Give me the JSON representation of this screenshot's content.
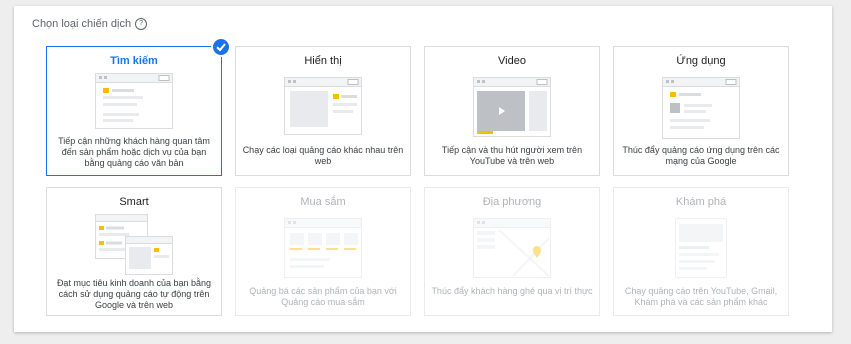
{
  "section": {
    "title": "Chọn loại chiến dịch",
    "help_icon": "help-circle-icon"
  },
  "colors": {
    "accent": "#1a73e8",
    "illustration_highlight": "#fbbc04",
    "disabled_text": "#b0b3b8"
  },
  "cards": [
    {
      "title": "Tìm kiếm",
      "description": "Tiếp cận những khách hàng quan tâm đến sản phẩm hoặc dịch vụ của bạn bằng quảng cáo văn bản",
      "selected": true,
      "disabled": false
    },
    {
      "title": "Hiển thị",
      "description": "Chạy các loại quảng cáo khác nhau trên web",
      "selected": false,
      "disabled": false
    },
    {
      "title": "Video",
      "description": "Tiếp cận và thu hút người xem trên YouTube và trên web",
      "selected": false,
      "disabled": false
    },
    {
      "title": "Ứng dụng",
      "description": "Thúc đẩy quảng cáo ứng dụng trên các mạng của Google",
      "selected": false,
      "disabled": false
    },
    {
      "title": "Smart",
      "description": "Đạt mục tiêu kinh doanh của bạn bằng cách sử dụng quảng cáo tự động trên Google và trên web",
      "selected": false,
      "disabled": false
    },
    {
      "title": "Mua sắm",
      "description": "Quảng bá các sản phẩm của bạn với Quảng cáo mua sắm",
      "selected": false,
      "disabled": true
    },
    {
      "title": "Địa phương",
      "description": "Thúc đẩy khách hàng ghé qua vị trí thực",
      "selected": false,
      "disabled": true
    },
    {
      "title": "Khám phá",
      "description": "Chạy quảng cáo trên YouTube, Gmail, Khám phá và các sản phẩm khác",
      "selected": false,
      "disabled": true
    }
  ]
}
